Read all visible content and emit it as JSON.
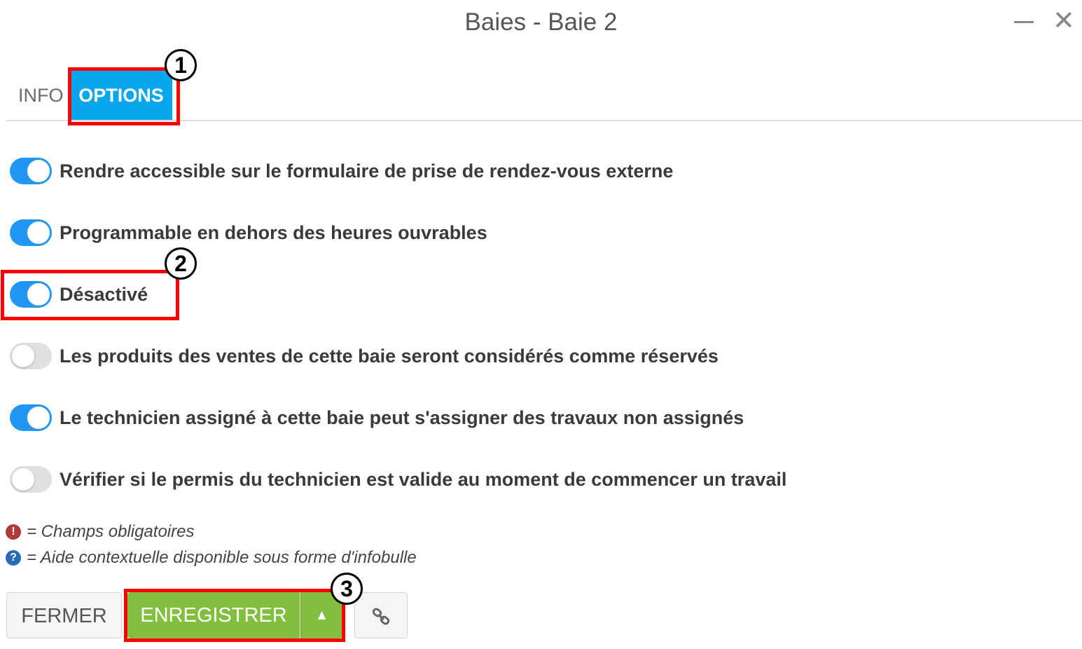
{
  "window": {
    "title": "Baies - Baie 2",
    "minimize_icon": "minimize-icon",
    "close_icon": "close-icon"
  },
  "tabs": [
    {
      "label": "INFO",
      "active": false
    },
    {
      "label": "OPTIONS",
      "active": true
    }
  ],
  "options": [
    {
      "label": "Rendre accessible sur le formulaire de prise de rendez-vous externe",
      "enabled": true
    },
    {
      "label": "Programmable en dehors des heures ouvrables",
      "enabled": true
    },
    {
      "label": "Désactivé",
      "enabled": true
    },
    {
      "label": "Les produits des ventes de cette baie seront considérés comme réservés",
      "enabled": false
    },
    {
      "label": "Le technicien assigné à cette baie peut s'assigner des travaux non assignés",
      "enabled": true
    },
    {
      "label": "Vérifier si le permis du technicien est valide au moment de commencer un travail",
      "enabled": false
    }
  ],
  "legend": {
    "required": "= Champs obligatoires",
    "help": "= Aide contextuelle disponible sous forme d'infobulle",
    "required_icon": "!",
    "help_icon": "?"
  },
  "buttons": {
    "close": "FERMER",
    "save": "ENREGISTRER",
    "save_caret": "▲",
    "link_icon": "link-icon"
  },
  "annotations": {
    "badge_1": "1",
    "badge_2": "2",
    "badge_3": "3",
    "highlight_color": "#ff0000"
  },
  "colors": {
    "tab_active": "#08a6ea",
    "toggle_on": "#2196f3",
    "save_button": "#82bf3f"
  }
}
